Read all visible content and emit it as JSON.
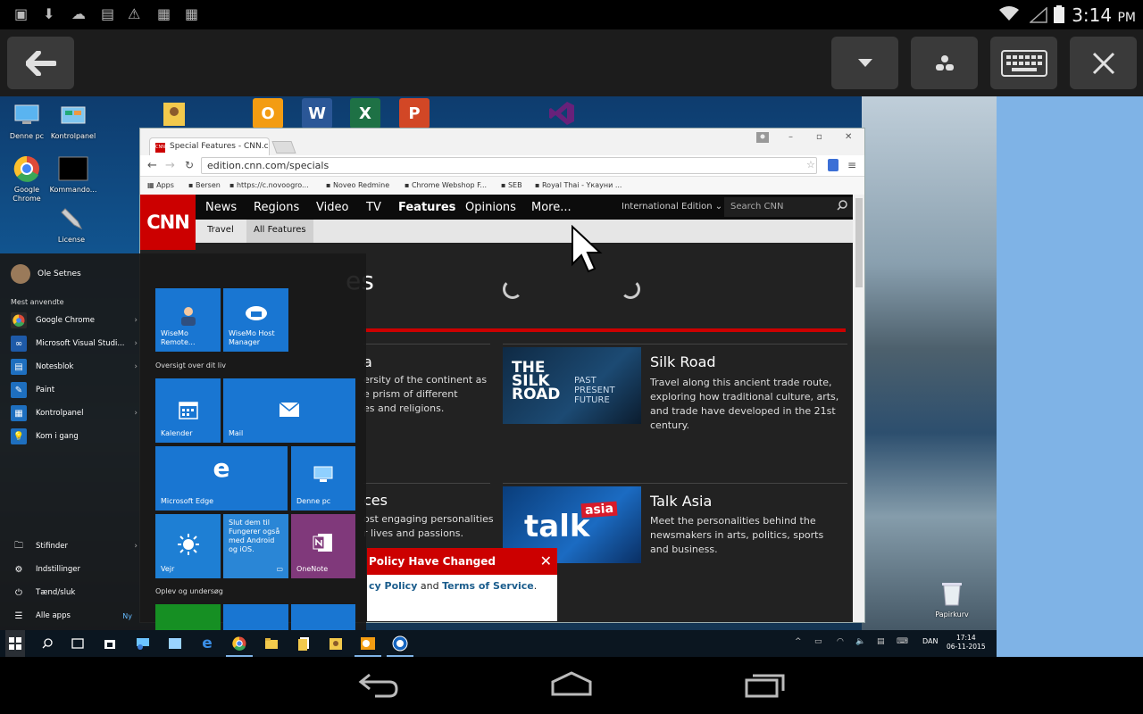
{
  "status_bar": {
    "time": "3:14",
    "ampm": "PM"
  },
  "desktop": {
    "icons": [
      "Denne pc",
      "Kontrolpanel",
      "Google Chrome",
      "Kommando...",
      "License",
      "Papirkurv"
    ]
  },
  "browser": {
    "tab_title": "Special Features - CNN.co",
    "url": "edition.cnn.com/specials",
    "bookmarks": [
      "Apps",
      "Bersen",
      "https://c.novoogro...",
      "Noveo Redmine",
      "Chrome Webshop F...",
      "SEB",
      "Royal Thai - Yкауни ..."
    ]
  },
  "cnn": {
    "logo": "CNN",
    "nav": [
      "News",
      "Regions",
      "Video",
      "TV",
      "Features",
      "Opinions",
      "More..."
    ],
    "active_nav": "Features",
    "edition": "International Edition",
    "search_placeholder": "Search CNN",
    "subnav": [
      "Travel",
      "All Features"
    ],
    "page_title": "es",
    "left_partial_1": {
      "title": "a",
      "desc": [
        "ersity of the continent as",
        "e prism of different",
        "es and religions."
      ]
    },
    "left_partial_2": {
      "title": "ces",
      "desc": [
        "ost engaging personalities",
        "r lives and passions."
      ]
    },
    "features": [
      {
        "title": "Silk Road",
        "desc": "Travel along this ancient trade route, exploring how traditional culture, arts, and trade have developed in the 21st century.",
        "thumb_line1": "THE SILK ROAD",
        "thumb_line2": "PAST PRESENT FUTURE"
      },
      {
        "title": "Talk Asia",
        "desc": "Meet the personalities behind the newsmakers in arts, politics, sports and business.",
        "thumb_word": "talk",
        "thumb_badge": "asia"
      }
    ],
    "policy": {
      "heading": "Policy Have Changed",
      "body_prefix": "",
      "privacy": "cy Policy",
      "and": " and ",
      "terms": "Terms of Service",
      "end": "."
    }
  },
  "start_menu": {
    "user": "Ole Setnes",
    "most_used_heading": "Mest anvendte",
    "items": [
      "Google Chrome",
      "Microsoft Visual Studi...",
      "Notesblok",
      "Paint",
      "Kontrolpanel",
      "Kom i gang"
    ],
    "bottom_items": [
      "Stifinder",
      "Indstillinger",
      "Tænd/sluk",
      "Alle apps"
    ],
    "new_badge": "Ny",
    "tiles": {
      "wisemo_remote": "WiseMo Remote...",
      "wisemo_host": "WiseMo Host Manager",
      "overview_heading": "Oversigt over dit liv",
      "calendar": "Kalender",
      "mail": "Mail",
      "edge": "Microsoft Edge",
      "denne_pc": "Denne pc",
      "weather": "Vejr",
      "connect_text": "Slut dem til Fungerer også med Android og iOS.",
      "onenote": "OneNote",
      "play_heading": "Oplev og undersøg"
    }
  },
  "taskbar": {
    "clock_time": "17:14",
    "clock_date": "06-11-2015",
    "lang": "DAN"
  }
}
